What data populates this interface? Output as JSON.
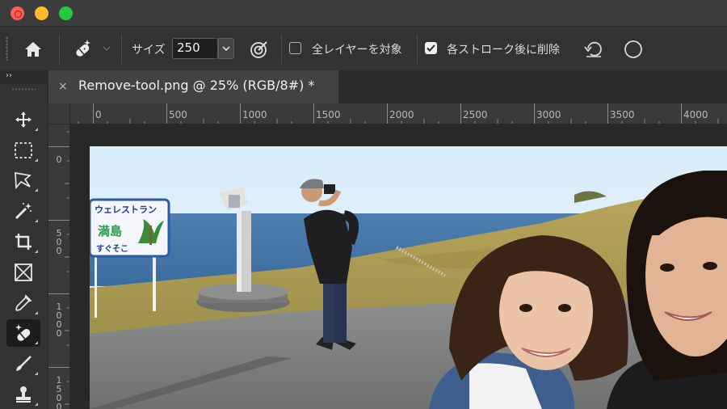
{
  "window": {
    "controls": [
      "close",
      "minimize",
      "maximize"
    ]
  },
  "options_bar": {
    "home_icon": "home-icon",
    "tool_icon": "remove-tool-icon",
    "size_label": "サイズ",
    "size_value": "250",
    "pressure_icon": "pressure-icon",
    "all_layers_label": "全レイヤーを対象",
    "all_layers_checked": false,
    "remove_after_stroke_label": "各ストローク後に削除",
    "remove_after_stroke_checked": true,
    "reset_icon": "rotate-icon",
    "circle_icon": "circle-icon"
  },
  "toolbar": {
    "collapse_label": "››",
    "tools": [
      {
        "name": "move-tool",
        "icon": "move-icon"
      },
      {
        "name": "marquee-tool",
        "icon": "marquee-icon"
      },
      {
        "name": "lasso-tool",
        "icon": "lasso-icon"
      },
      {
        "name": "magic-wand-tool",
        "icon": "magic-wand-icon"
      },
      {
        "name": "crop-tool",
        "icon": "crop-icon"
      },
      {
        "name": "frame-tool",
        "icon": "frame-icon"
      },
      {
        "name": "eyedropper-tool",
        "icon": "eyedropper-icon"
      },
      {
        "name": "remove-tool",
        "icon": "remove-tool-icon",
        "active": true
      },
      {
        "name": "brush-tool",
        "icon": "brush-icon"
      },
      {
        "name": "stamp-tool",
        "icon": "stamp-icon"
      }
    ]
  },
  "document_tab": {
    "close_label": "×",
    "title": "Remove-tool.png @ 25% (RGB/8#) *"
  },
  "ruler": {
    "horizontal": [
      "0",
      "500",
      "1000",
      "1500",
      "2000",
      "2500",
      "3000",
      "3500",
      "4000"
    ],
    "vertical": [
      "0",
      "500",
      "1000",
      "1500"
    ]
  },
  "sign": {
    "line1": "ウェレストラン",
    "line2": "満島",
    "line3": "すぐそこ"
  },
  "colors": {
    "chrome_dark": "#2b2b2b",
    "panel": "#323232",
    "canvas_bg": "#282828",
    "accent_close": "#ff5f57",
    "accent_min": "#febc2e",
    "accent_max": "#28c840"
  }
}
